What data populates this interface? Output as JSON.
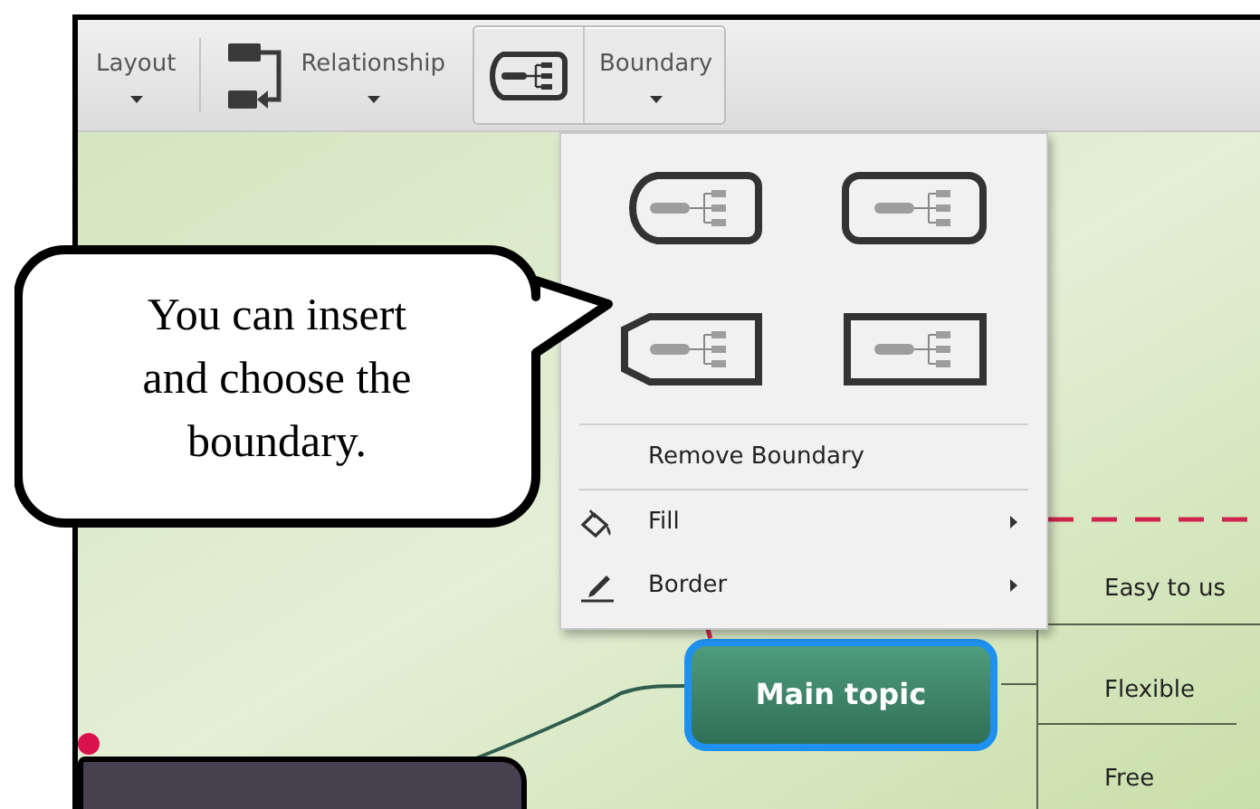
{
  "toolbar": {
    "buttons": [
      {
        "label": "Layout",
        "kind": "text",
        "selected": false
      },
      {
        "label": "Relationship",
        "kind": "relationship",
        "selected": false
      },
      {
        "label": "Boundary",
        "kind": "boundary",
        "selected": true
      }
    ]
  },
  "boundary_menu": {
    "shapes": [
      {
        "kind": "tapered-rounded"
      },
      {
        "kind": "rounded"
      },
      {
        "kind": "tapered-square"
      },
      {
        "kind": "square"
      }
    ],
    "items": [
      {
        "label": "Remove Boundary",
        "kind": "plain",
        "submenu": false
      },
      {
        "label": "Fill",
        "kind": "fill",
        "submenu": true
      },
      {
        "label": "Border",
        "kind": "border",
        "submenu": true
      }
    ]
  },
  "callout": {
    "text": "You can insert and choose the boundary."
  },
  "mind_map": {
    "main_topic": {
      "label": "Main topic",
      "selected": true
    },
    "subtopics": [
      {
        "label": "Easy to us"
      },
      {
        "label": "Flexible"
      },
      {
        "label": "Free"
      }
    ]
  }
}
